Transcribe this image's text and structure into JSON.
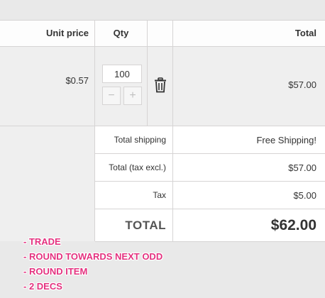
{
  "header": {
    "unit_price": "Unit price",
    "qty": "Qty",
    "total": "Total"
  },
  "product": {
    "unit_price": "$0.57",
    "quantity": "100",
    "minus": "−",
    "plus": "+",
    "total": "$57.00",
    "delete_icon": "trash-icon"
  },
  "summary": {
    "shipping_label": "Total shipping",
    "shipping_value": "Free Shipping!",
    "tax_excl_label": "Total (tax excl.)",
    "tax_excl_value": "$57.00",
    "tax_label": "Tax",
    "tax_value": "$5.00",
    "total_label": "TOTAL",
    "total_value": "$62.00"
  },
  "notes": [
    "- TRADE",
    "- ROUND TOWARDS NEXT ODD",
    "- ROUND ITEM",
    "- 2 DECS"
  ],
  "colors": {
    "note": "#e4317f",
    "background": "#e9e9e9",
    "border": "#d6d4d4"
  }
}
